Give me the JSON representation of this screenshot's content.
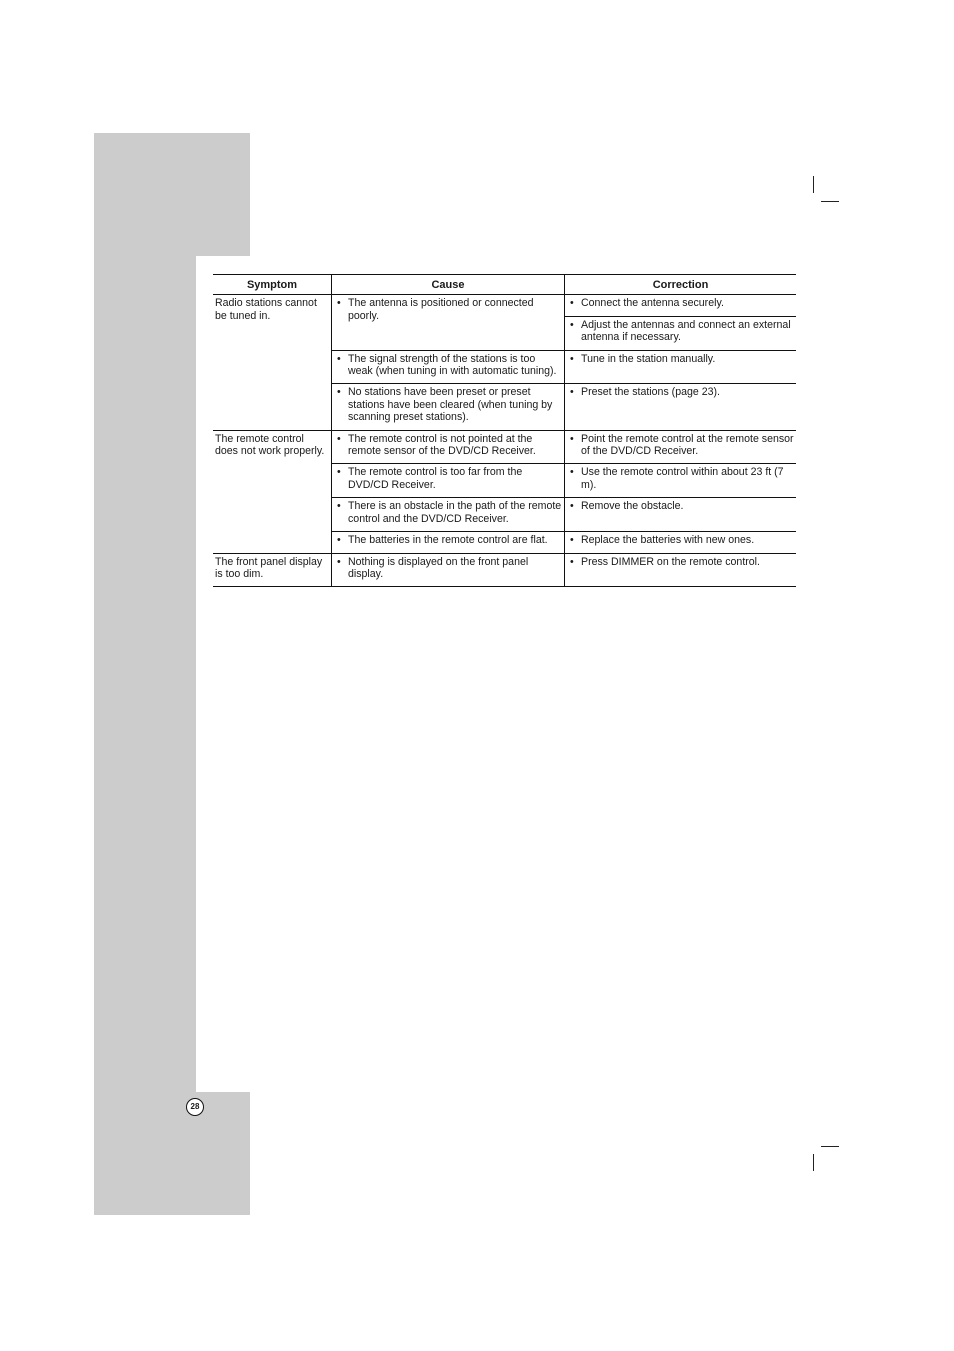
{
  "page": {
    "number": "28"
  },
  "table": {
    "headers": {
      "symptom": "Symptom",
      "cause": "Cause",
      "correction": "Correction"
    },
    "bullet": "•",
    "groups": [
      {
        "symptom": "Radio stations cannot be tuned in.",
        "rows": [
          {
            "cause": "The antenna is positioned or  connected poorly.",
            "corrections": [
              "Connect the antenna securely.",
              "Adjust the antennas and connect an external antenna if necessary."
            ]
          },
          {
            "cause": "The signal strength of the stations is too weak (when tuning in with automatic tuning).",
            "corrections": [
              "Tune in the station manually."
            ]
          },
          {
            "cause": "No stations have been preset or preset stations have been cleared (when tuning by scanning preset stations).",
            "corrections": [
              "Preset the stations (page 23)."
            ]
          }
        ]
      },
      {
        "symptom": "The remote control does not work properly.",
        "rows": [
          {
            "cause": "The remote control is not pointed at the remote sensor of the DVD/CD Receiver.",
            "corrections": [
              "Point the remote control at the remote sensor of the DVD/CD Receiver."
            ]
          },
          {
            "cause": "The remote control is too far from the DVD/CD Receiver.",
            "corrections": [
              "Use the remote control within about 23 ft (7 m)."
            ]
          },
          {
            "cause": "There is an obstacle in the path of the remote control and the DVD/CD Receiver.",
            "corrections": [
              "Remove the obstacle."
            ]
          },
          {
            "cause": "The batteries in the remote control are flat.",
            "corrections": [
              "Replace the batteries with new ones."
            ]
          }
        ]
      },
      {
        "symptom": "The front panel display is too dim.",
        "rows": [
          {
            "cause": "Nothing is displayed on the front panel display.",
            "corrections": [
              "Press DIMMER on the remote control."
            ]
          }
        ]
      }
    ]
  }
}
